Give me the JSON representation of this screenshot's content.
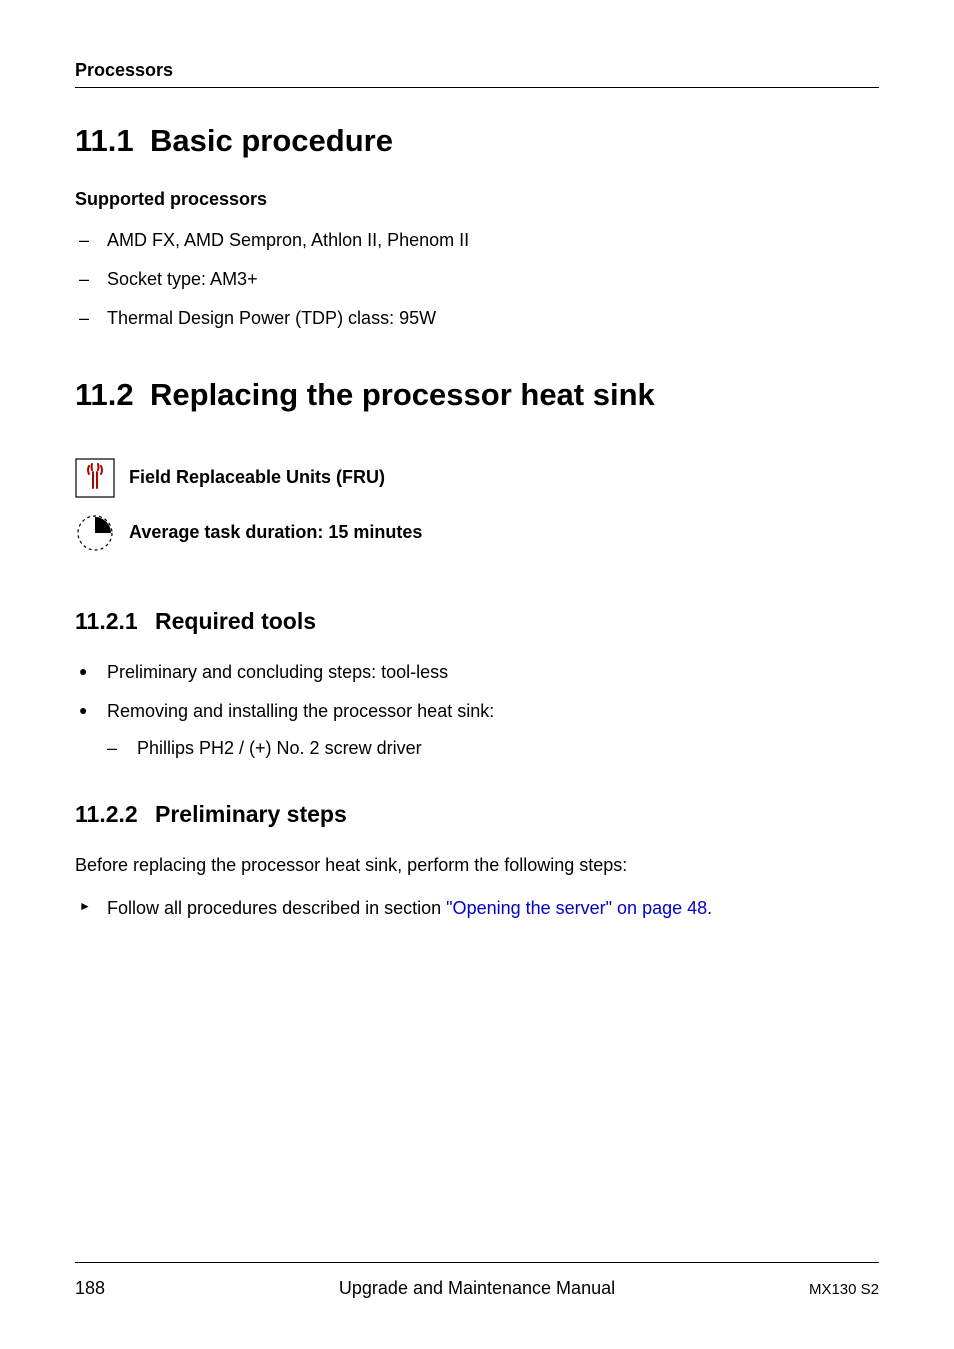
{
  "header": {
    "section_label": "Processors"
  },
  "section_11_1": {
    "number": "11.1",
    "title": "Basic procedure",
    "subheading": "Supported processors",
    "items": [
      "AMD FX, AMD Sempron, Athlon II, Phenom II",
      "Socket type: AM3+",
      "Thermal Design Power (TDP) class: 95W"
    ]
  },
  "section_11_2": {
    "number": "11.2",
    "title": "Replacing the processor heat sink",
    "fru_label": "Field Replaceable Units (FRU)",
    "duration_label": "Average task duration: 15 minutes"
  },
  "section_11_2_1": {
    "number": "11.2.1",
    "title": "Required tools",
    "items": [
      "Preliminary and concluding steps: tool-less",
      "Removing and installing the processor heat sink:"
    ],
    "sub_item": "Phillips PH2 / (+) No. 2 screw driver"
  },
  "section_11_2_2": {
    "number": "11.2.2",
    "title": "Preliminary steps",
    "intro": "Before replacing the processor heat sink, perform the following steps:",
    "step_prefix": "Follow all procedures described in section ",
    "step_link": "\"Opening the server\" on page 48",
    "step_suffix": "."
  },
  "footer": {
    "page_number": "188",
    "center": "Upgrade and Maintenance Manual",
    "right": "MX130 S2"
  }
}
